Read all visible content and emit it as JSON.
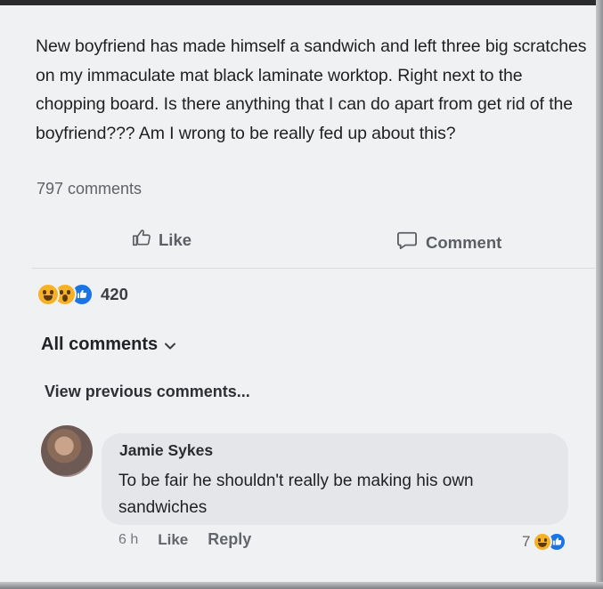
{
  "post": {
    "text": "New boyfriend has made himself a sandwich and left three big scratches on my immaculate mat black laminate worktop. Right next to the chopping board. Is there anything that I can do apart from get rid of the boyfriend??? Am I wrong to be really fed up about this?",
    "comments_count": "797 comments"
  },
  "actions": {
    "like_label": "Like",
    "comment_label": "Comment",
    "like_icon": "thumbs-up-outline-icon",
    "comment_icon": "speech-bubble-outline-icon"
  },
  "reactions": {
    "icons": [
      "haha-reaction-icon",
      "wow-reaction-icon",
      "like-reaction-icon"
    ],
    "count": "420"
  },
  "comments_section": {
    "filter_label": "All comments",
    "filter_icon": "chevron-down-icon",
    "view_previous": "View previous comments..."
  },
  "comment": {
    "author": "Jamie Sykes",
    "text": "To be fair he shouldn't really be making his own sandwiches",
    "time": "6 h",
    "like_label": "Like",
    "reply_label": "Reply",
    "reaction_count": "7",
    "reaction_icons": [
      "haha-reaction-icon",
      "like-reaction-icon"
    ]
  },
  "colors": {
    "background": "#f0f1f3",
    "bubble": "#e4e6e9",
    "like_blue": "#1b74e4",
    "emoji_yellow": "#f7b125"
  }
}
